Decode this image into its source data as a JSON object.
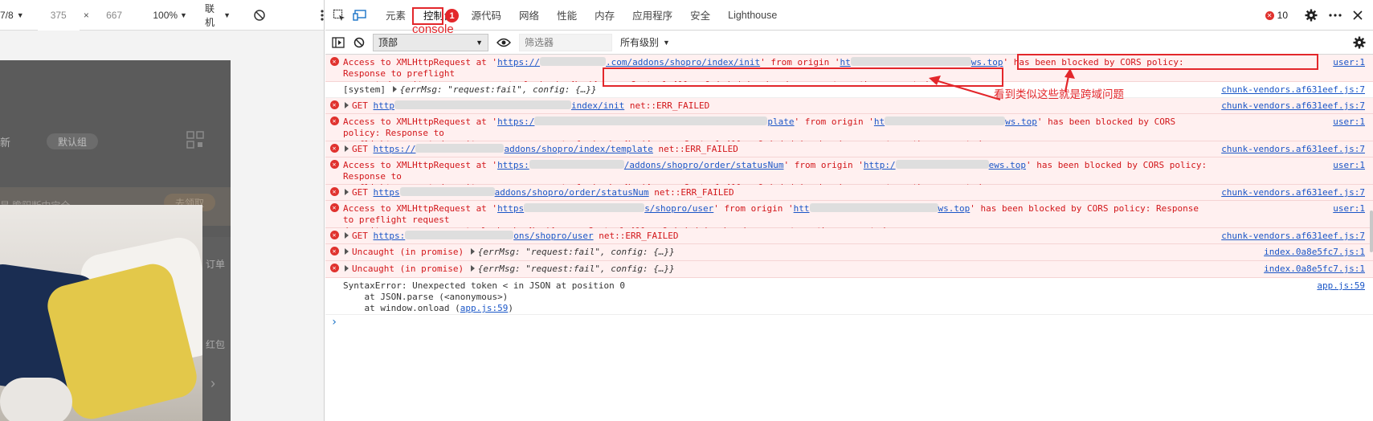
{
  "device_toolbar": {
    "device": "7/8",
    "width": "375",
    "times": "×",
    "height": "667",
    "zoom": "100%",
    "network": "联机"
  },
  "preview": {
    "text_new": "新",
    "default_tag": "默认组",
    "bottom_text": "是  瞻阳断中宝全",
    "right_btn": "去领取",
    "side_1": "订单",
    "side_2": "红包",
    "chevron": "›"
  },
  "devtools": {
    "tabs": [
      "元素",
      "控制台",
      "源代码",
      "网络",
      "性能",
      "内存",
      "应用程序",
      "安全",
      "Lighthouse"
    ],
    "active_tab": "控制台",
    "error_count": "10",
    "context": "顶部",
    "filter_placeholder": "筛选器",
    "levels": "所有级别"
  },
  "annotations": {
    "badge": "1",
    "console_label": "console",
    "note": "看到类似这些就是跨域问题"
  },
  "console": {
    "rows": [
      {
        "p1": "Access to XMLHttpRequest at '",
        "u1": "https://",
        "u1b": ".com/addons/shopro/index/init",
        "p2": "' from origin '",
        "u2": "ht",
        "u2b": "ws.top",
        "p3": "' has been blocked by CORS policy: Response to preflight",
        "line2": "request doesn't pass access control check: No 'Access-Control-Allow-Origin' header is present on the requested resource.",
        "src": "user:1"
      },
      {
        "prefix": "[system] ",
        "obj": "{errMsg: \"request:fail\", config: {…}}",
        "src": "chunk-vendors.af631eef.js:7"
      },
      {
        "get": "GET ",
        "u": "http",
        "ub": "index/init",
        "tail": " net::ERR_FAILED",
        "src": "chunk-vendors.af631eef.js:7"
      },
      {
        "p1": "Access to XMLHttpRequest at '",
        "u1": "https:/",
        "u1b": "plate",
        "p2": "' from origin '",
        "u2": "ht",
        "u2b": "ws.top",
        "p3": "' has been blocked by CORS policy: Response to",
        "line2": "preflight request doesn't pass access control check: No 'Access-Control-Allow-Origin' header is present on the requested resource.",
        "src": "user:1"
      },
      {
        "get": "GET ",
        "u": "https://",
        "ub": "addons/shopro/index/template",
        "tail": " net::ERR_FAILED",
        "src": "chunk-vendors.af631eef.js:7"
      },
      {
        "p1": "Access to XMLHttpRequest at '",
        "u1": "https:",
        "u1b": "/addons/shopro/order/statusNum",
        "p2": "' from origin '",
        "u2": "http:/",
        "u2b": "ews.top",
        "p3": "' has been blocked by CORS policy: Response to",
        "line2": "preflight request doesn't pass access control check: No 'Access-Control-Allow-Origin' header is present on the requested resource.",
        "src": "user:1"
      },
      {
        "get": "GET ",
        "u": "https",
        "ub": "addons/shopro/order/statusNum",
        "tail": " net::ERR_FAILED",
        "src": "chunk-vendors.af631eef.js:7"
      },
      {
        "p1": "Access to XMLHttpRequest at '",
        "u1": "https",
        "u1b": "s/shopro/user",
        "p2": "' from origin '",
        "u2": "htt",
        "u2b": "ws.top",
        "p3": "' has been blocked by CORS policy: Response to preflight request",
        "line2": "doesn't pass access control check: No 'Access-Control-Allow-Origin' header is present on the requested resource.",
        "src": "user:1"
      },
      {
        "get": "GET ",
        "u": "https:",
        "ub": "ons/shopro/user",
        "tail": " net::ERR_FAILED",
        "src": "chunk-vendors.af631eef.js:7"
      },
      {
        "prefix": "Uncaught (in promise) ",
        "obj": "{errMsg: \"request:fail\", config: {…}}",
        "src": "index.0a8e5fc7.js:1"
      },
      {
        "prefix": "Uncaught (in promise) ",
        "obj": "{errMsg: \"request:fail\", config: {…}}",
        "src": "index.0a8e5fc7.js:1"
      },
      {
        "line1": "SyntaxError: Unexpected token < in JSON at position 0",
        "line2": "    at JSON.parse (<anonymous>)",
        "line3a": "    at window.onload (",
        "line3u": "app.js:59",
        "line3b": ")",
        "src": "app.js:59"
      }
    ],
    "prompt": "›"
  }
}
